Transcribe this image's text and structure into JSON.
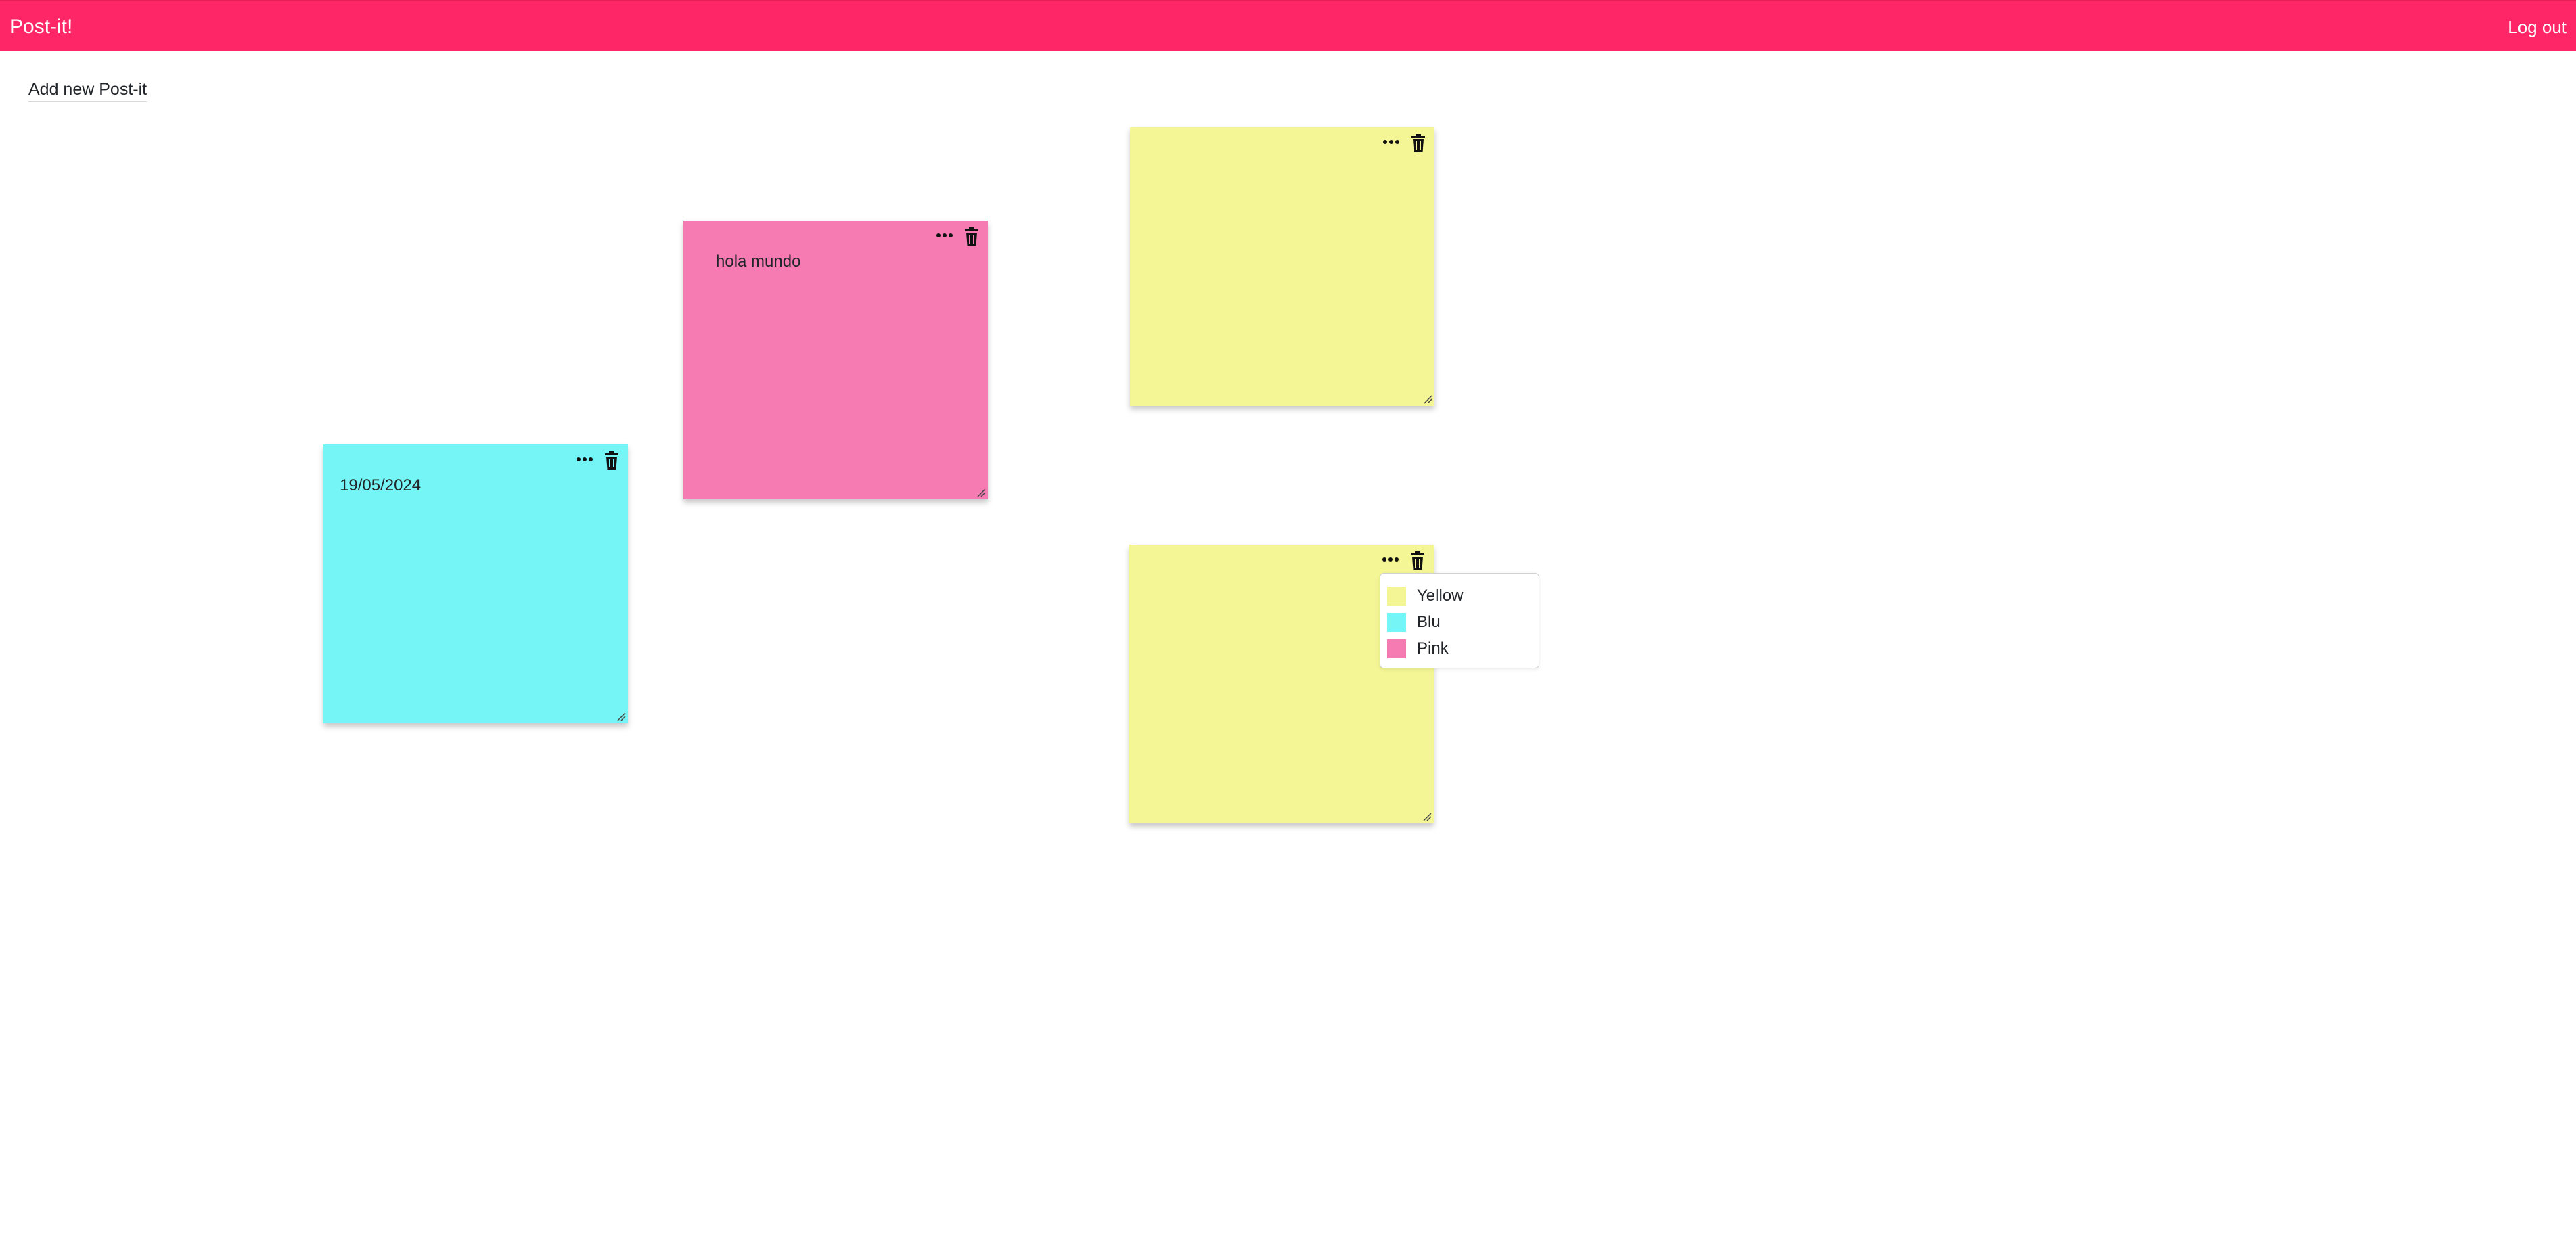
{
  "app": {
    "brand": "Post-it!",
    "logout_label": "Log out",
    "add_label": "Add new Post-it",
    "header_color": "#ff2667"
  },
  "notes": [
    {
      "id": "note-blue",
      "color": "#76f5f7",
      "text": "19/05/2024"
    },
    {
      "id": "note-pink",
      "color": "#f77bb3",
      "text": "hola mundo"
    },
    {
      "id": "note-yellow-top",
      "color": "#f4f595",
      "text": ""
    },
    {
      "id": "note-yellow-bottom",
      "color": "#f4f595",
      "text": ""
    }
  ],
  "color_menu": {
    "items": [
      {
        "label": "Yellow",
        "color": "#f4f595"
      },
      {
        "label": "Blu",
        "color": "#76f5f7"
      },
      {
        "label": "Pink",
        "color": "#f77bb3"
      }
    ]
  },
  "icons": {
    "options": "more-options-icon",
    "delete": "trash-icon",
    "resize": "resize-handle-icon"
  }
}
